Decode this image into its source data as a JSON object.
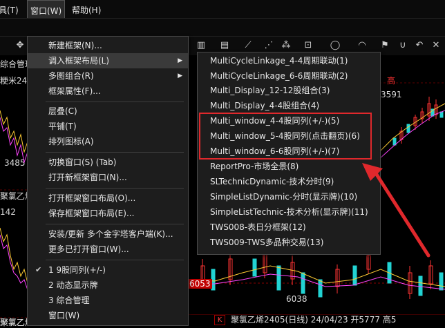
{
  "menubar": {
    "tools_partial": "工具(T)",
    "window": "窗口(W)",
    "help": "帮助(H)"
  },
  "background": {
    "tab_label": "综合管理",
    "left_label_1": "粳米24",
    "left_label_2": "聚氯乙烯",
    "left_label_3": "聚氯乙烯",
    "bottom_label": "聚氯乙烯",
    "value_3485": "3485",
    "value_142": "142",
    "value_3591": "3591",
    "value_6053": "6053",
    "value_6038": "6038",
    "right_top_text": "高",
    "bottom_status": "聚氯乙烯2405(日线) 24/04/23 开5777 高5",
    "bottom_k_btn": "K",
    "bottom_right_partial": "49",
    "colors": {
      "up": "#ff3333",
      "down": "#22d3d3",
      "highlight": "#e0282c",
      "menu_bg": "#1d1d1d"
    }
  },
  "main_menu": {
    "items": [
      {
        "label": "新建框架(N)..."
      },
      {
        "label": "调入框架布局(L)",
        "has_submenu": true
      },
      {
        "label": "多图组合(R)",
        "has_submenu": true
      },
      {
        "label": "框架属性(F)..."
      },
      {
        "label": "层叠(C)"
      },
      {
        "label": "平铺(T)"
      },
      {
        "label": "排列图标(A)"
      },
      {
        "label": "切换窗口(S)    (Tab)"
      },
      {
        "label": "打开新框架窗口(N)..."
      },
      {
        "label": "打开框架窗口布局(O)..."
      },
      {
        "label": "保存框架窗口布局(E)..."
      },
      {
        "label": "安装/更新 多个金字塔客户端(K)..."
      },
      {
        "label": "更多已打开窗口(W)..."
      },
      {
        "label": "1 9股同列(+/-)",
        "checked": true
      },
      {
        "label": "2 动态显示牌"
      },
      {
        "label": "3 综合管理"
      },
      {
        "label": "窗口(W)"
      }
    ]
  },
  "sub_menu": {
    "items": [
      {
        "label": "MultiCycleLinkage_4-4周期联动(1)"
      },
      {
        "label": "MultiCycleLinkage_6-6周期联动(2)"
      },
      {
        "label": "Multi_Display_12-12股组合(3)"
      },
      {
        "label": "Multi_Display_4-4股组合(4)"
      },
      {
        "label": "Multi_window_4-4股同列(+/-)(5)"
      },
      {
        "label": "Multi_window_5-4股同列(点击翻页)(6)"
      },
      {
        "label": "Multi_window_6-6股同列(+/-)(7)"
      },
      {
        "label": "ReportPro-市场全景(8)"
      },
      {
        "label": "SLTechnicDynamic-技术分时(9)"
      },
      {
        "label": "SimpleListDynamic-分时(显示牌)(10)"
      },
      {
        "label": "SimpleListTechnic-技术分析(显示牌)(11)"
      },
      {
        "label": "TWS008-表日分框架(12)"
      },
      {
        "label": "TWS009-TWS多品种交易(13)"
      }
    ]
  }
}
